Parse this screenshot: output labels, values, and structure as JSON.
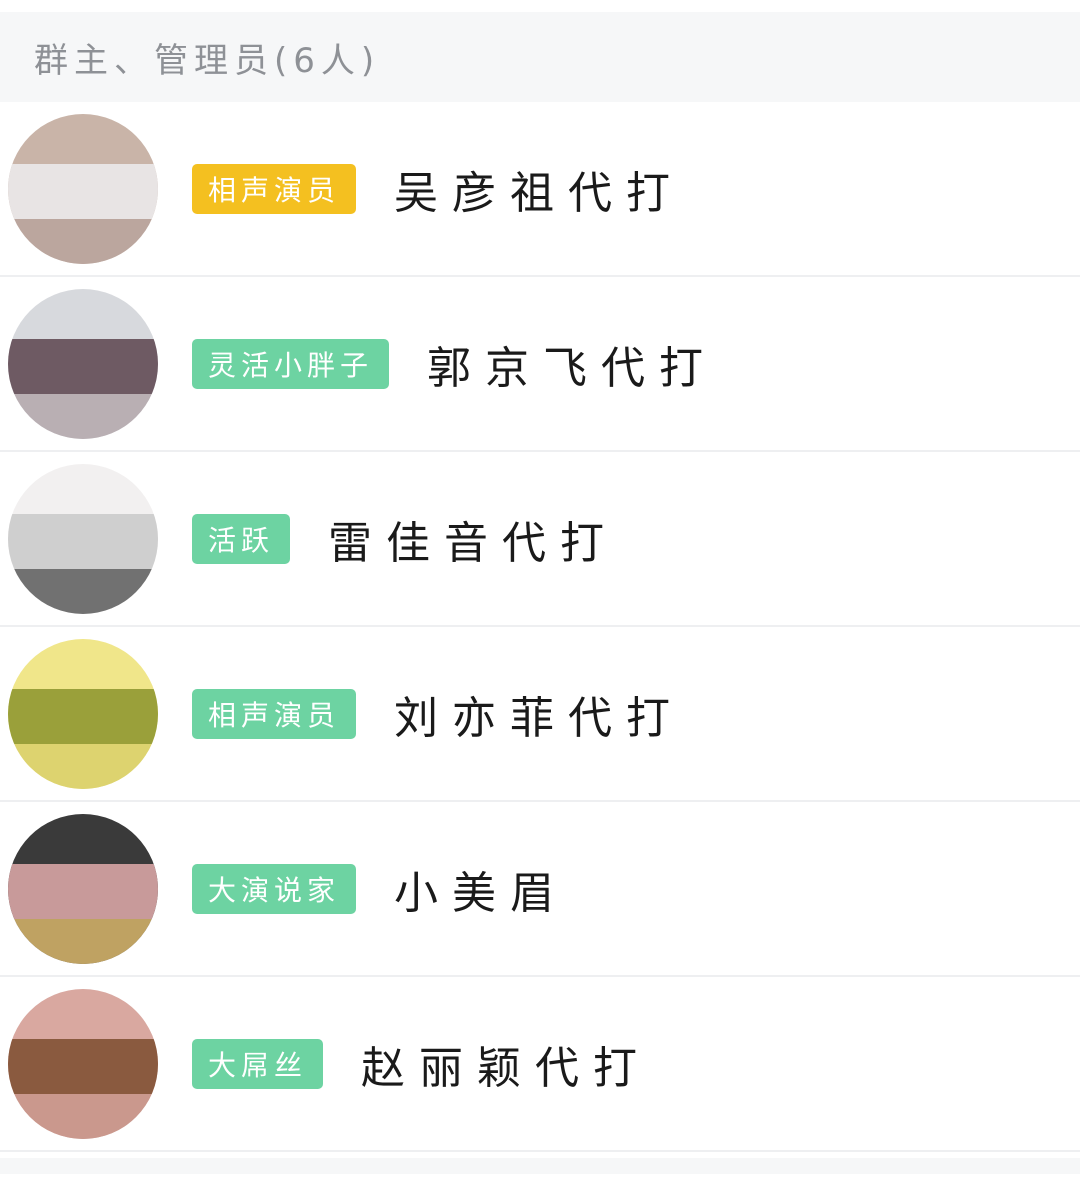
{
  "section": {
    "title": "群主、管理员(6人)"
  },
  "members": [
    {
      "badge": "相声演员",
      "badge_color": "#f4c020",
      "name": "吴彦祖代打",
      "avatar_colors": [
        "#c9b4a8",
        "#e8e4e4",
        "#b9a39c"
      ]
    },
    {
      "badge": "灵活小胖子",
      "badge_color": "#6dd3a2",
      "name": "郭京飞代打",
      "avatar_colors": [
        "#d7d9dd",
        "#6e5a63",
        "#b4a7ab"
      ]
    },
    {
      "badge": "活跃",
      "badge_color": "#6dd3a2",
      "name": "雷佳音代打",
      "avatar_colors": [
        "#f2f0f0",
        "#cfcfcf",
        "#5a5a5a"
      ]
    },
    {
      "badge": "相声演员",
      "badge_color": "#6dd3a2",
      "name": "刘亦菲代打",
      "avatar_colors": [
        "#f0e68a",
        "#9aa03a",
        "#d9cf6a"
      ]
    },
    {
      "badge": "大演说家",
      "badge_color": "#6dd3a2",
      "name": "小美眉",
      "avatar_colors": [
        "#3a3a3a",
        "#c89a9a",
        "#d7b56a"
      ]
    },
    {
      "badge": "大屌丝",
      "badge_color": "#6dd3a2",
      "name": "赵丽颖代打",
      "avatar_colors": [
        "#d9a8a0",
        "#8a5a3f",
        "#c79589"
      ]
    }
  ]
}
